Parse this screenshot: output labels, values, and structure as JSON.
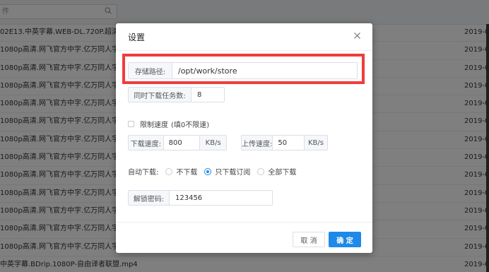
{
  "background": {
    "search": {
      "placeholder_partial": "件"
    },
    "rows": [
      {
        "name": "02E13.中英字幕.WEB-DL.720P.超清字幕",
        "date": "2019-0"
      },
      {
        "name": "1080p高清.网飞官方中字.亿万同人字幕",
        "date": "2019-0"
      },
      {
        "name": "1080p高清.网飞官方中字.亿万同人字幕",
        "date": "2019-0"
      },
      {
        "name": "1080p高清.网飞官方中字.亿万同人字幕",
        "date": "2019-0"
      },
      {
        "name": "1080p高清.网飞官方中字.亿万同人字幕",
        "date": "2019-0"
      },
      {
        "name": "1080p高清.网飞官方中字.亿万同人字幕",
        "date": "2019-0"
      },
      {
        "name": "1080p高清.网飞官方中字.亿万同人字幕",
        "date": "2019-0"
      },
      {
        "name": "1080p高清.网飞官方中字.亿万同人字幕",
        "date": "2019-0"
      },
      {
        "name": "1080p高清.网飞官方中字.亿万同人字幕",
        "date": "2019-0"
      },
      {
        "name": "1080p高清.网飞官方中字.亿万同人字幕",
        "date": "2019-0"
      },
      {
        "name": "1080p高清.网飞官方中字.亿万同人字幕",
        "date": "2019-0"
      },
      {
        "name": "1080p高清.网飞官方中字.亿万同人字幕",
        "date": "2019-0"
      },
      {
        "name": "1080p高清.网飞官方中字.亿万同人字幕",
        "date": "2019-0"
      },
      {
        "name": "中英字幕.BDrip.1080P-自由译者联盟.mp4",
        "date": "2019-0"
      }
    ]
  },
  "dialog": {
    "title": "设置",
    "storage_path": {
      "label": "存储路径:",
      "value": "/opt/work/store"
    },
    "concurrent_tasks": {
      "label": "同时下载任务数:",
      "value": "8"
    },
    "limit_speed": {
      "label": "限制速度",
      "hint": "(填0不限速)",
      "checked": false
    },
    "download_speed": {
      "label": "下载速度:",
      "value": "800",
      "unit": "KB/s"
    },
    "upload_speed": {
      "label": "上传速度:",
      "value": "50",
      "unit": "KB/s"
    },
    "auto_download": {
      "label": "自动下载:",
      "options": [
        "不下载",
        "只下载订阅",
        "全部下载"
      ],
      "selected": "只下载订阅"
    },
    "unlock_password": {
      "label": "解锁密码:",
      "value": "123456"
    },
    "buttons": {
      "cancel": "取 消",
      "ok": "确 定"
    }
  },
  "colors": {
    "primary": "#1e89e8",
    "highlight": "#f03c3c",
    "overlay": "rgba(0,0,0,0.5)"
  }
}
